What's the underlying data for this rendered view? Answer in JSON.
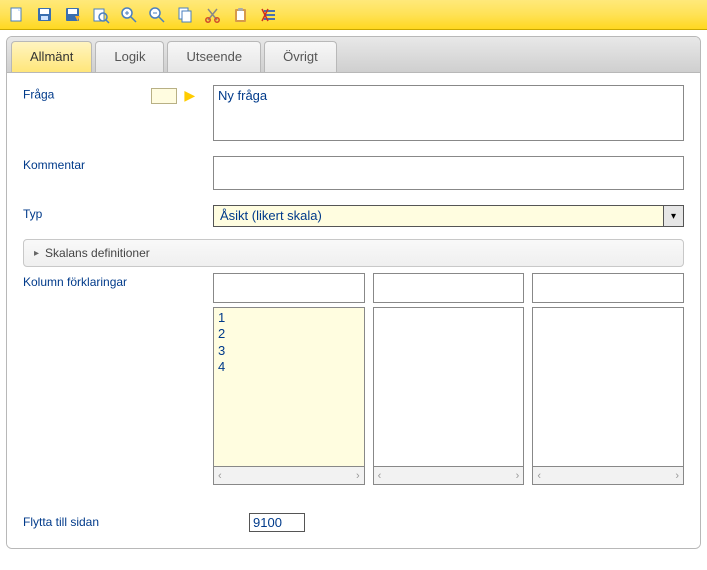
{
  "toolbar": {
    "icons": [
      "new",
      "save",
      "save-as",
      "find",
      "zoom-in",
      "zoom-out",
      "copy",
      "cut",
      "paste",
      "clear-format"
    ]
  },
  "tabs": [
    {
      "id": "allmant",
      "label": "Allmänt",
      "active": true
    },
    {
      "id": "logik",
      "label": "Logik",
      "active": false
    },
    {
      "id": "utseende",
      "label": "Utseende",
      "active": false
    },
    {
      "id": "ovrigt",
      "label": "Övrigt",
      "active": false
    }
  ],
  "form": {
    "fraga_label": "Fråga",
    "fraga_value": "Ny fråga",
    "kommentar_label": "Kommentar",
    "kommentar_value": "",
    "typ_label": "Typ",
    "typ_value": "Åsikt (likert skala)",
    "skalans_label": "Skalans definitioner",
    "kolumn_label": "Kolumn förklaringar",
    "col1_items": [
      "1",
      "2",
      "3",
      "4"
    ],
    "flytta_label": "Flytta till sidan",
    "flytta_value": "9100"
  }
}
